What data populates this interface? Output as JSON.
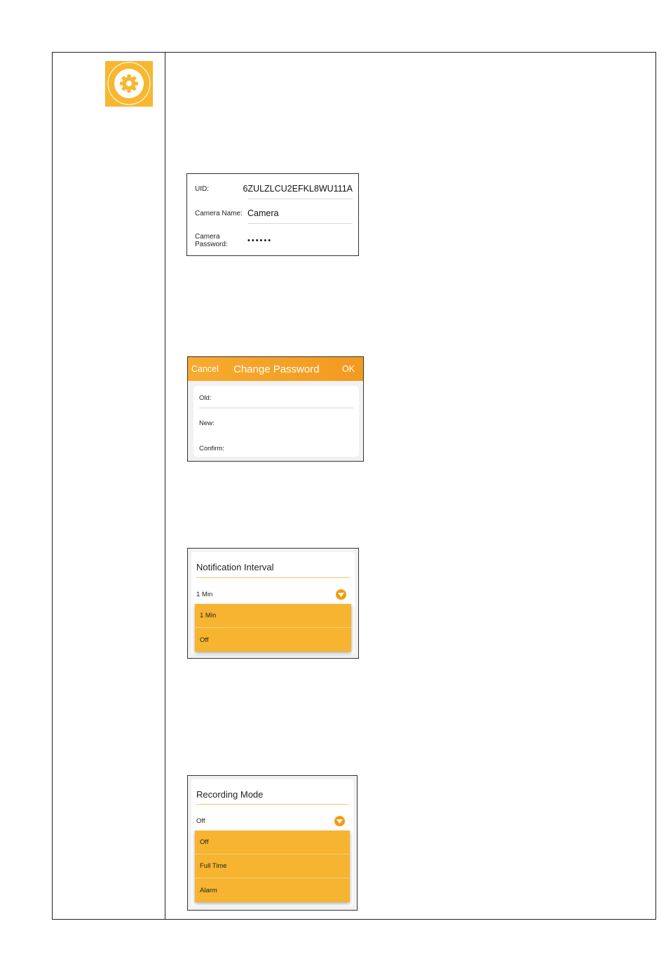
{
  "camera_info": {
    "uid_label": "UID:",
    "uid_value": "6ZULZLCU2EFKL8WU111A",
    "name_label": "Camera Name:",
    "name_value": "Camera",
    "password_label_line1": "Camera",
    "password_label_line2": "Password:",
    "password_value": "••••••"
  },
  "change_password": {
    "cancel_label": "Cancel",
    "title": "Change Password",
    "ok_label": "OK",
    "old_label": "Old:",
    "new_label": "New:",
    "confirm_label": "Confirm:"
  },
  "notification_interval": {
    "title": "Notification Interval",
    "selected": "1 Min",
    "options": [
      "1 Min",
      "Off"
    ]
  },
  "recording_mode": {
    "title": "Recording Mode",
    "selected": "Off",
    "options": [
      "Off",
      "Full Time",
      "Alarm"
    ]
  },
  "colors": {
    "accent": "#f7b731",
    "header_orange": "#f39a20",
    "arrow_orange": "#f39c12",
    "menu_orange": "#f6b430"
  }
}
